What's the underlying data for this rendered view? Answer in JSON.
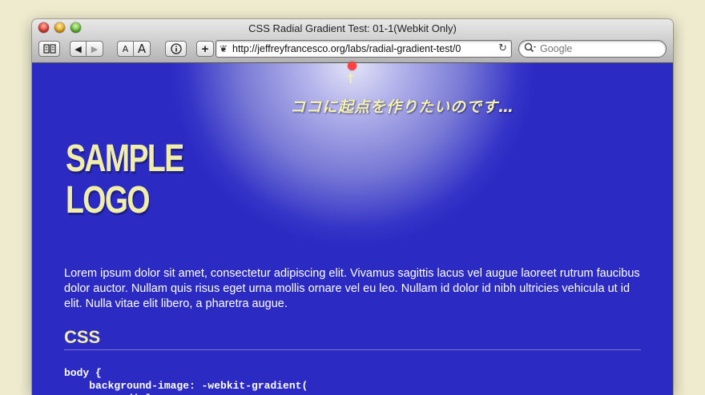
{
  "window": {
    "title": "CSS Radial Gradient Test: 01-1(Webkit Only)"
  },
  "toolbar": {
    "font_small": "A",
    "font_large": "A",
    "add_label": "+",
    "url": "http://jeffreyfrancesco.org/labs/radial-gradient-test/0",
    "search_placeholder": "Google"
  },
  "page": {
    "annotation": "ココに起点を作りたいのです…",
    "logo_line1": "SAMPLE",
    "logo_line2": "LOGO",
    "lorem": "Lorem ipsum dolor sit amet, consectetur adipiscing elit. Vivamus sagittis lacus vel augue laoreet rutrum faucibus dolor auctor. Nullam quis risus eget urna mollis ornare vel eu leo. Nullam id dolor id nibh ultricies vehicula ut id elit. Nulla vitae elit libero, a pharetra augue.",
    "css_heading": "CSS",
    "code": "body {\n    background-image: -webkit-gradient(\n        radial,"
  },
  "colors": {
    "page_bg": "#2b2bc4",
    "accent_yellow": "#f1eeaa",
    "marker_red": "#ff4040",
    "desktop": "#efebcf"
  },
  "icons": {
    "bookmarks": "book-icon",
    "back": "arrow-left-icon",
    "forward": "arrow-right-icon",
    "info": "info-icon",
    "reload": "reload-icon",
    "search": "magnifier-icon"
  }
}
